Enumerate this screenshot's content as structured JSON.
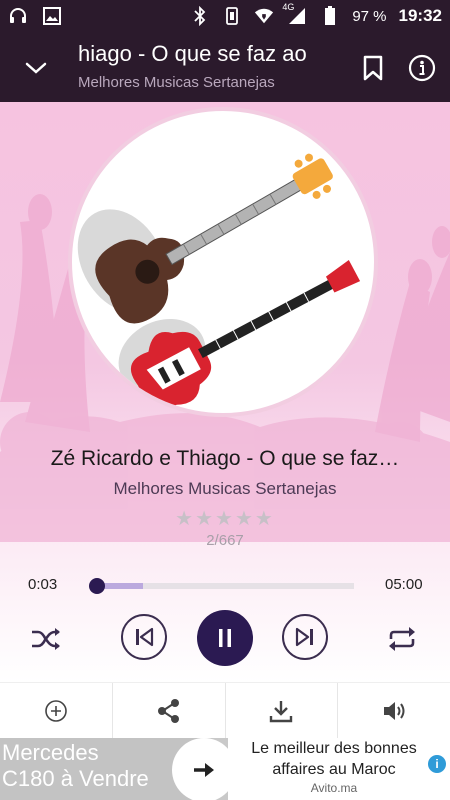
{
  "status_bar": {
    "battery": "97 %",
    "time": "19:32",
    "network": "4G"
  },
  "header": {
    "title": "hiago - O que se faz ao",
    "subtitle": "Melhores Musicas Sertanejas"
  },
  "player": {
    "song_title": "Zé Ricardo e Thiago - O que se faz…",
    "album": "Melhores Musicas Sertanejas",
    "rating_stars": "★★★★★",
    "rating_value": 0,
    "track_position": "2/667",
    "current_time": "0:03",
    "total_time": "05:00",
    "progress_fraction": 0.01,
    "buffer_fraction": 0.19,
    "state": "playing"
  },
  "actions": [
    "add-icon",
    "share-icon",
    "download-icon",
    "volume-icon"
  ],
  "ad": {
    "left_text_line1": "Mercedes",
    "left_text_line2": "C180 à Vendre",
    "right_line1": "Le meilleur des bonnes",
    "right_line2": "affaires au Maroc",
    "brand": "Avito.ma",
    "info": "i"
  },
  "colors": {
    "header_bg": "#2b1a2c",
    "accent": "#2b1a52",
    "progress": "#7a5fc8",
    "background_pink": "#f6c3e0"
  }
}
